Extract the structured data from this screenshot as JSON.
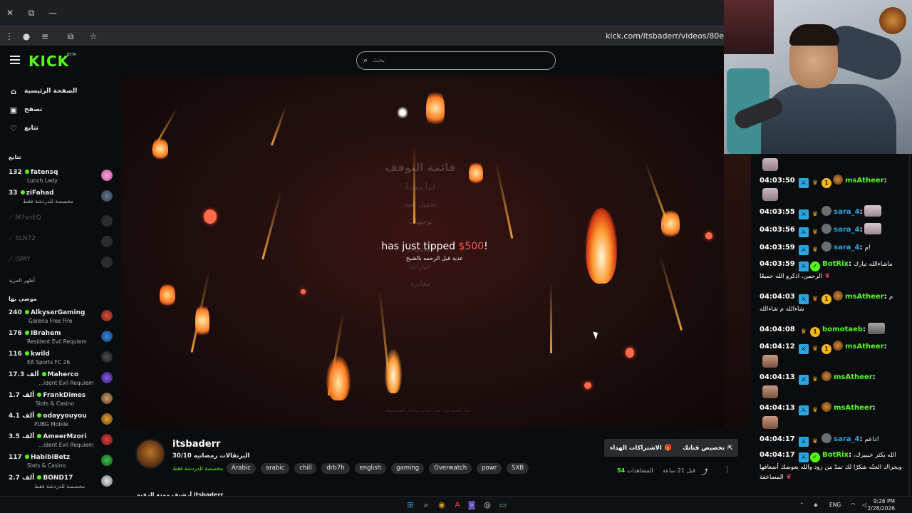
{
  "browser": {
    "url": "kick.com/itsbaderr/videos/80e",
    "window_controls": {
      "close": "✕",
      "restore": "⧉",
      "minimize": "—"
    }
  },
  "header": {
    "logo": "KICK",
    "logo_badge": "BETA",
    "search_placeholder": "بحث"
  },
  "sidebar": {
    "nav": [
      {
        "label": "الصفحة الرئيسية",
        "icon": "home-icon"
      },
      {
        "label": "تصفح",
        "icon": "browse-icon"
      },
      {
        "label": "تتابع",
        "icon": "heart-icon"
      }
    ],
    "following_title": "تتابع",
    "following": [
      {
        "count": "132",
        "name": "fatensq",
        "sub": "Lunch Lady",
        "live": true
      },
      {
        "count": "33",
        "name": "ziFahad",
        "sub": "مخصصة للدردشة فقط",
        "live": true
      },
      {
        "count": "",
        "name": "M7snEQ",
        "sub": "",
        "live": false
      },
      {
        "count": "",
        "name": "SLN72",
        "sub": "",
        "live": false
      },
      {
        "count": "",
        "name": "ISMY",
        "sub": "",
        "live": false
      }
    ],
    "show_more": "أظهر المزيد",
    "recommended_title": "موصى بها",
    "recommended": [
      {
        "count": "240",
        "name": "AlkysarGaming",
        "sub": "Garena Free Fire"
      },
      {
        "count": "176",
        "name": "IBrahem",
        "sub": "Resident Evil Requiem"
      },
      {
        "count": "116",
        "name": "kwild",
        "sub": "EA Sports FC 26"
      },
      {
        "count": "17.3 ألف",
        "name": "Maherco",
        "sub": "...ident Evil Requiem"
      },
      {
        "count": "1.7 ألف",
        "name": "FrankDimes",
        "sub": "Slots & Casino"
      },
      {
        "count": "4.1 ألف",
        "name": "odayyouyou",
        "sub": "PUBG Mobile"
      },
      {
        "count": "3.5 ألف",
        "name": "AmeerMzori",
        "sub": "...ident Evil Requiem"
      },
      {
        "count": "117",
        "name": "HabibiBetz",
        "sub": "Slots & Casino"
      },
      {
        "count": "2.7 ألف",
        "name": "BOND17",
        "sub": "مخصصة للدردشة فقط"
      }
    ]
  },
  "video": {
    "ghost_menu": {
      "title": "قائمة التوقف",
      "items": [
        "ابدأ مجدداً",
        "تحميل لعبة",
        "توجيهات",
        "التحديات",
        "خيارات",
        "مغادرة"
      ]
    },
    "tip_text": "has just tipped",
    "tip_amount": "$500",
    "tip_suffix": "!",
    "tip_sub": "عدية قبل الرحمه بالشيخ",
    "ghost_footer": "ابدأ اللعبة من عند أحدث بياناتك المحفوظة"
  },
  "stream": {
    "name": "itsbaderr",
    "title": "30/10 البرتقالات رمضانيه",
    "category": "مخصصة للدردشة فقط",
    "tags": [
      "Arabic",
      "arabic",
      "chill",
      "drb7h",
      "english",
      "gaming",
      "Overwatch",
      "powr",
      "SXB"
    ],
    "btn_subscriptions": "الاشتراكات الهداء",
    "btn_customize": "تخصيص قناتك",
    "views_label": "المشاهدات",
    "views": "54",
    "time_ago": "قبل 21 ساعة",
    "cut_text": "أرشيف ممتع الرفيق itsbaderr"
  },
  "chat": {
    "messages": [
      {
        "time": "04:03:50",
        "badges": [
          "mod",
          "crown",
          "sub",
          "lion"
        ],
        "user": "msAtheer",
        "color": "#53fc18",
        "text": "",
        "emote": false
      },
      {
        "time": "04:03:55",
        "badges": [
          "mod",
          "crown",
          "gray"
        ],
        "user": "sara_4",
        "color": "#2aa7e0",
        "text": "",
        "emote": true
      },
      {
        "time": "04:03:56",
        "badges": [
          "mod",
          "crown",
          "gray"
        ],
        "user": "sara_4",
        "color": "#2aa7e0",
        "text": "",
        "emote": true
      },
      {
        "time": "04:03:59",
        "badges": [
          "mod",
          "crown",
          "gray"
        ],
        "user": "sara_4",
        "color": "#2aa7e0",
        "text": "م!",
        "emote": false
      },
      {
        "time": "04:03:59",
        "badges": [
          "mod",
          "ver"
        ],
        "user": "BotRix",
        "color": "#53fc18",
        "text": "ماشاءالله تبارك الرحمن، اذكرو الله جميعًا",
        "emote": false
      },
      {
        "time": "04:04:03",
        "badges": [
          "mod",
          "crown",
          "sub",
          "lion"
        ],
        "user": "msAtheer",
        "color": "#53fc18",
        "text": "م شاءالله م شاءالله",
        "emote": false
      },
      {
        "time": "04:04:08",
        "badges": [
          "crown",
          "sub"
        ],
        "user": "bomotaeb",
        "color": "#53fc18",
        "text": "",
        "emote": true
      },
      {
        "time": "04:04:12",
        "badges": [
          "mod",
          "crown",
          "sub",
          "lion"
        ],
        "user": "msAtheer",
        "color": "#53fc18",
        "text": "",
        "emote": false
      },
      {
        "time": "04:04:13",
        "badges": [
          "mod",
          "crown",
          "lion"
        ],
        "user": "msAtheer",
        "color": "#53fc18",
        "text": "",
        "emote": false
      },
      {
        "time": "04:04:13",
        "badges": [
          "mod",
          "crown",
          "lion"
        ],
        "user": "msAtheer",
        "color": "#53fc18",
        "text": "",
        "emote": false
      },
      {
        "time": "04:04:17",
        "badges": [
          "mod",
          "crown",
          "gray"
        ],
        "user": "sara_4",
        "color": "#2aa7e0",
        "text": "داعم!",
        "emote": false
      },
      {
        "time": "04:04:17",
        "badges": [
          "mod",
          "ver"
        ],
        "user": "BotRix",
        "color": "#53fc18",
        "text": "الله يكثر خيبيرك، ويجزاك الجنّه شكرًا لك تمدّ من زود والله يعوضك أضعافها المضاعفة",
        "emote": false
      }
    ]
  },
  "taskbar": {
    "lang": "ENG",
    "time": "9:26 PM",
    "date": "2/28/2026"
  }
}
